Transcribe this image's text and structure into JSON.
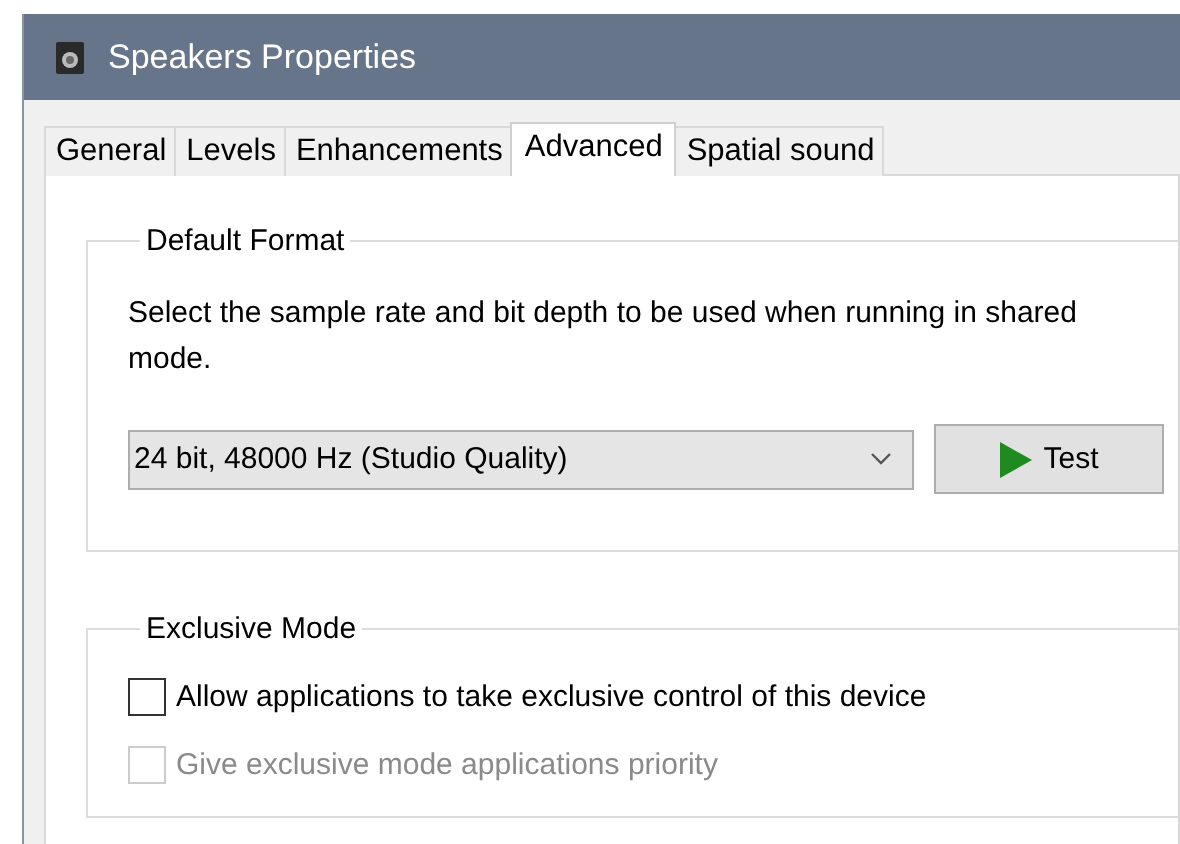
{
  "window": {
    "title": "Speakers Properties"
  },
  "tabs": [
    {
      "label": "General",
      "selected": false
    },
    {
      "label": "Levels",
      "selected": false
    },
    {
      "label": "Enhancements",
      "selected": false
    },
    {
      "label": "Advanced",
      "selected": true
    },
    {
      "label": "Spatial sound",
      "selected": false
    }
  ],
  "default_format": {
    "title": "Default Format",
    "description": "Select the sample rate and bit depth to be used when running in shared mode.",
    "format": "24 bit, 48000 Hz (Studio Quality)",
    "test_button": "Test"
  },
  "exclusive_mode": {
    "title": "Exclusive Mode",
    "options": [
      {
        "label": "Allow applications to take exclusive control of this device",
        "checked": false,
        "disabled": false
      },
      {
        "label": "Give exclusive mode applications priority",
        "checked": false,
        "disabled": true
      }
    ]
  }
}
